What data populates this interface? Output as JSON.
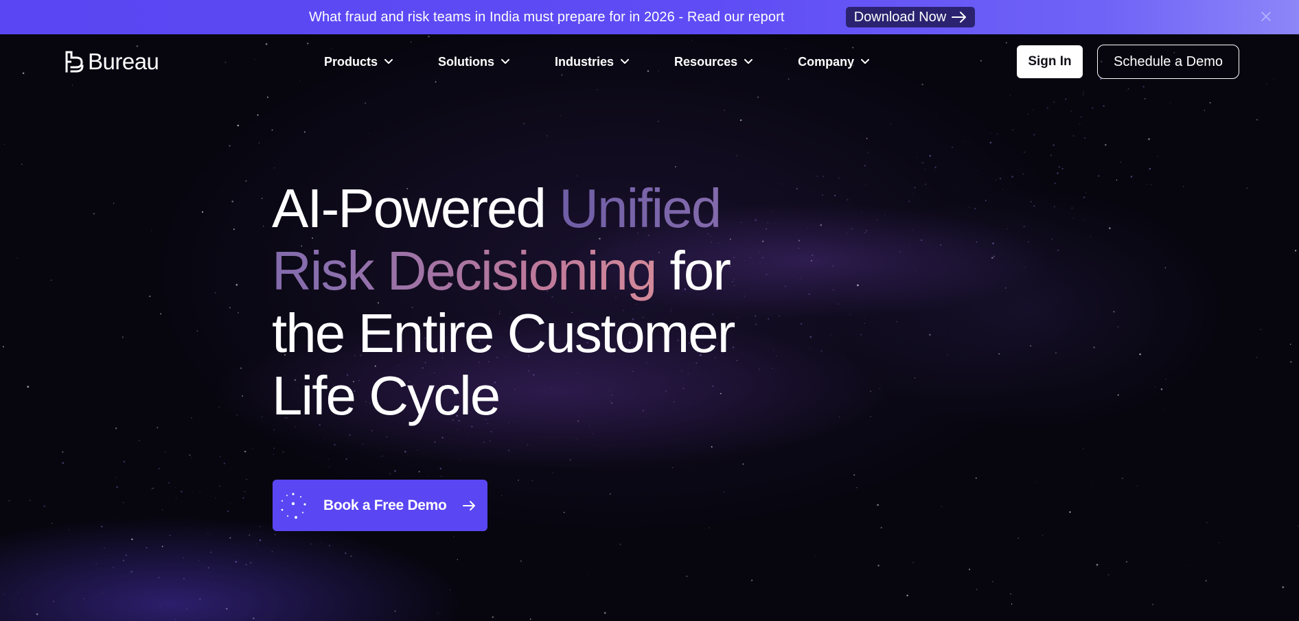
{
  "announcement": {
    "text": "What fraud and risk teams in India must prepare for in 2026 - Read our report",
    "button_label": "Download Now"
  },
  "brand": {
    "name": "Bureau",
    "accent_color": "#5a46f2"
  },
  "nav": {
    "items": [
      {
        "label": "Products"
      },
      {
        "label": "Solutions"
      },
      {
        "label": "Industries"
      },
      {
        "label": "Resources"
      },
      {
        "label": "Company"
      }
    ],
    "sign_in_label": "Sign In",
    "schedule_demo_label": "Schedule a Demo"
  },
  "hero": {
    "title_part1": "AI-Powered ",
    "title_accent": "Unified Risk Decisioning",
    "title_part2": " for the Entire Customer Life Cycle",
    "cta_label": "Book a Free Demo"
  }
}
